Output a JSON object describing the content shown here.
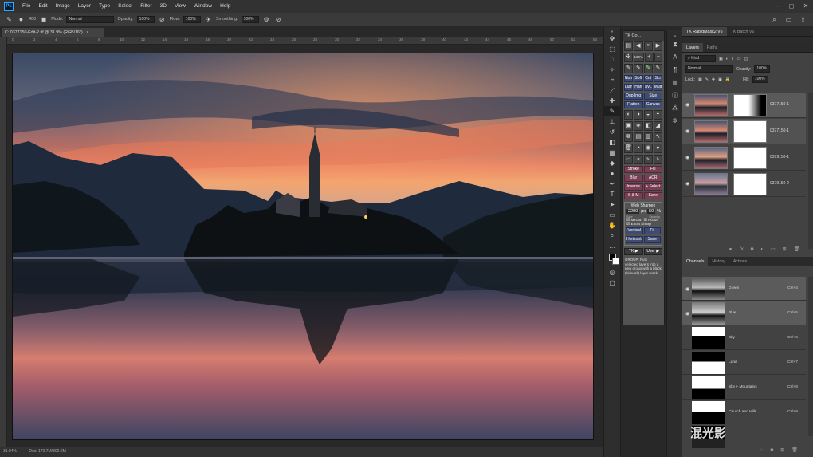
{
  "app": {
    "logo": "Ps",
    "menus": [
      "File",
      "Edit",
      "Image",
      "Layer",
      "Type",
      "Select",
      "Filter",
      "3D",
      "View",
      "Window",
      "Help"
    ],
    "window_controls": [
      "–",
      "◻",
      "✕"
    ]
  },
  "options": {
    "brush_size": "400",
    "mode_label": "Mode:",
    "mode_value": "Normal",
    "opacity_label": "Opacity:",
    "opacity_value": "100%",
    "flow_label": "Flow:",
    "flow_value": "100%",
    "smoothing_label": "Smoothing:",
    "smoothing_value": "100%"
  },
  "document": {
    "tab_title": "C: 0377150-Edit-2.tif @ 31.9% (RGB/16*)",
    "close": "×",
    "zoom": "31.94%",
    "doc_info": "Doc: 170.7M/800.2M",
    "ruler_ticks": [
      "0",
      "2",
      "4",
      "6",
      "8",
      "10",
      "12",
      "14",
      "16",
      "18",
      "20",
      "22",
      "24",
      "26",
      "28",
      "30",
      "32",
      "34",
      "36",
      "38",
      "40",
      "42",
      "44",
      "46",
      "48",
      "50",
      "52",
      "54"
    ]
  },
  "tk_panel": {
    "title": "TK Co...",
    "rows": [
      [
        "Norm",
        "Soft",
        "Cnt",
        "Scr"
      ],
      [
        "Lum",
        "Hard",
        "OvL",
        "Mult"
      ],
      [
        "Dup Img",
        "Size"
      ],
      [
        "Flatten",
        "Canvas"
      ]
    ],
    "rows2": [
      [
        "Stroke",
        "Fill"
      ],
      [
        "Blur",
        "ACR"
      ],
      [
        "Inverse",
        "+ Select"
      ],
      [
        "S & M",
        "Save"
      ]
    ],
    "web_sharpen": "Web Sharpen",
    "size_value": "2200",
    "px": "px",
    "pct_value": "50",
    "pct": "%",
    "size_caption": "Size",
    "opacity_caption": "Opacity",
    "srgb": "sRGB",
    "action": "Action",
    "extra_sharp": "Extra Sharp",
    "vertical": "Vertical",
    "fit": "Fit",
    "horizontal": "Horizontal",
    "save": "Save",
    "tk_btn": "TK ▶",
    "user_btn": "User ▶",
    "note": "GROUP: Puts selected layers into a new group with a black (hide-All) layer mask."
  },
  "right": {
    "tabs_top": [
      "TK RapidMask2 V6",
      "TK Batch V6"
    ],
    "layers_tabs": [
      "Layers",
      "Paths"
    ],
    "kind": "Kind",
    "blend": "Normal",
    "opacity_label": "Opacity:",
    "opacity_value": "100%",
    "lock_label": "Lock:",
    "fill_label": "Fill:",
    "fill_value": "100%",
    "layers": [
      {
        "name": "0377150-1"
      },
      {
        "name": "0377150-1"
      },
      {
        "name": "0379150-1"
      },
      {
        "name": "0379150-2"
      }
    ],
    "channels_tabs": [
      "Channels",
      "History",
      "Actions"
    ],
    "channels": [
      {
        "name": "Green",
        "key": "Ctrl+4"
      },
      {
        "name": "Blue",
        "key": "Ctrl+5"
      },
      {
        "name": "Sky",
        "key": "Ctrl+6"
      },
      {
        "name": "Land",
        "key": "Ctrl+7"
      },
      {
        "name": "Sky + Mountains",
        "key": "Ctrl+8"
      },
      {
        "name": "Church and Hills",
        "key": "Ctrl+9"
      }
    ]
  },
  "watermark": "混光影",
  "colors": {
    "tk_blue": "#3e4c73",
    "tk_red": "#7a3e52",
    "panel": "#424242",
    "selected": "#5a5a5a"
  }
}
